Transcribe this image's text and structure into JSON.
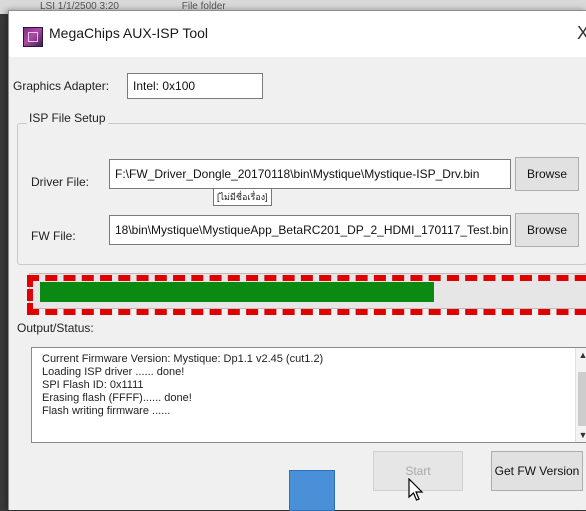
{
  "background": {
    "columns": [
      "LSI 1/1/2500 3:20",
      "File folder"
    ]
  },
  "window": {
    "title": "MegaChips AUX-ISP Tool",
    "close_glyph": "X"
  },
  "graphics_adapter": {
    "label": "Graphics Adapter:",
    "value": "Intel: 0x100"
  },
  "isp_file_setup": {
    "title": "ISP File Setup",
    "driver_label": "Driver File:",
    "driver_value": "F:\\FW_Driver_Dongle_20170118\\bin\\Mystique\\Mystique-ISP_Drv.bin",
    "fw_label": "FW File:",
    "fw_value": "18\\bin\\Mystique\\MystiqueApp_BetaRC201_DP_2_HDMI_170117_Test.bin",
    "browse_label": "Browse",
    "tooltip": "[ไม่มีชื่อเรื่อง]"
  },
  "progress": {
    "fraction": 0.73,
    "fill_color": "#0a8a12",
    "highlight_color": "#e00000"
  },
  "output": {
    "label": "Output/Status:",
    "lines": [
      "Current Firmware Version: Mystique: Dp1.1 v2.45  (cut1.2)",
      "Loading ISP driver ...... done!",
      "SPI Flash ID: 0x1111",
      "Erasing flash (FFFF)...... done!",
      "Flash writing firmware ......"
    ]
  },
  "buttons": {
    "start": "Start",
    "get_fw_version": "Get FW Version"
  },
  "icons": {
    "app": "megachips-app-icon",
    "cursor": "mouse-pointer-icon"
  }
}
